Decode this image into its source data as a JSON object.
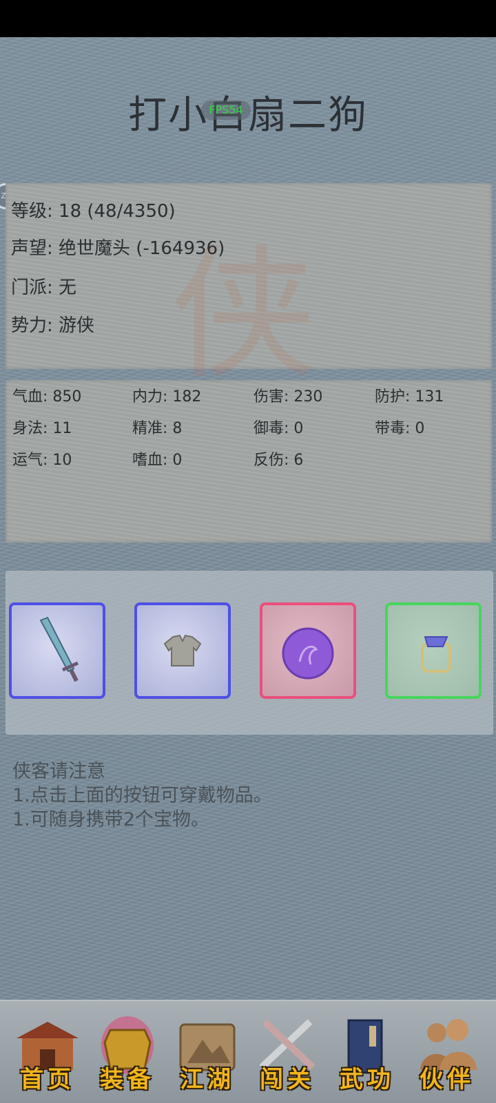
{
  "header": {
    "title": "打小白扇二狗",
    "fps": "FPS54",
    "float_button": "ZZ"
  },
  "info": {
    "level": "等级: 18 (48/4350)",
    "reputation": "声望: 绝世魔头 (-164936)",
    "sect": "门派: 无",
    "faction": "势力:  游侠"
  },
  "stats": [
    "气血: 850",
    "内力: 182",
    "伤害: 230",
    "防护: 131",
    "身法: 11",
    "精准: 8",
    "御毒: 0",
    "带毒: 0",
    "运气: 10",
    "嗜血: 0",
    "反伤: 6"
  ],
  "equipment": {
    "slots": [
      {
        "icon": "sword-icon",
        "color": "#4f4fe6"
      },
      {
        "icon": "armor-icon",
        "color": "#4f4fe6"
      },
      {
        "icon": "purple-orb-icon",
        "color": "#ea4f7d"
      },
      {
        "icon": "ring-icon",
        "color": "#46d65a"
      }
    ]
  },
  "notice": {
    "heading": "侠客请注意",
    "line1": "1.点击上面的按钮可穿戴物品。",
    "line2": "1.可随身携带2个宝物。"
  },
  "nav": {
    "items": [
      {
        "label": "首页",
        "icon": "house-icon"
      },
      {
        "label": "装备",
        "icon": "armor-icon"
      },
      {
        "label": "江湖",
        "icon": "scroll-map-icon"
      },
      {
        "label": "闯关",
        "icon": "crossed-swords-icon"
      },
      {
        "label": "武功",
        "icon": "book-icon"
      },
      {
        "label": "伙伴",
        "icon": "people-icon"
      }
    ]
  }
}
